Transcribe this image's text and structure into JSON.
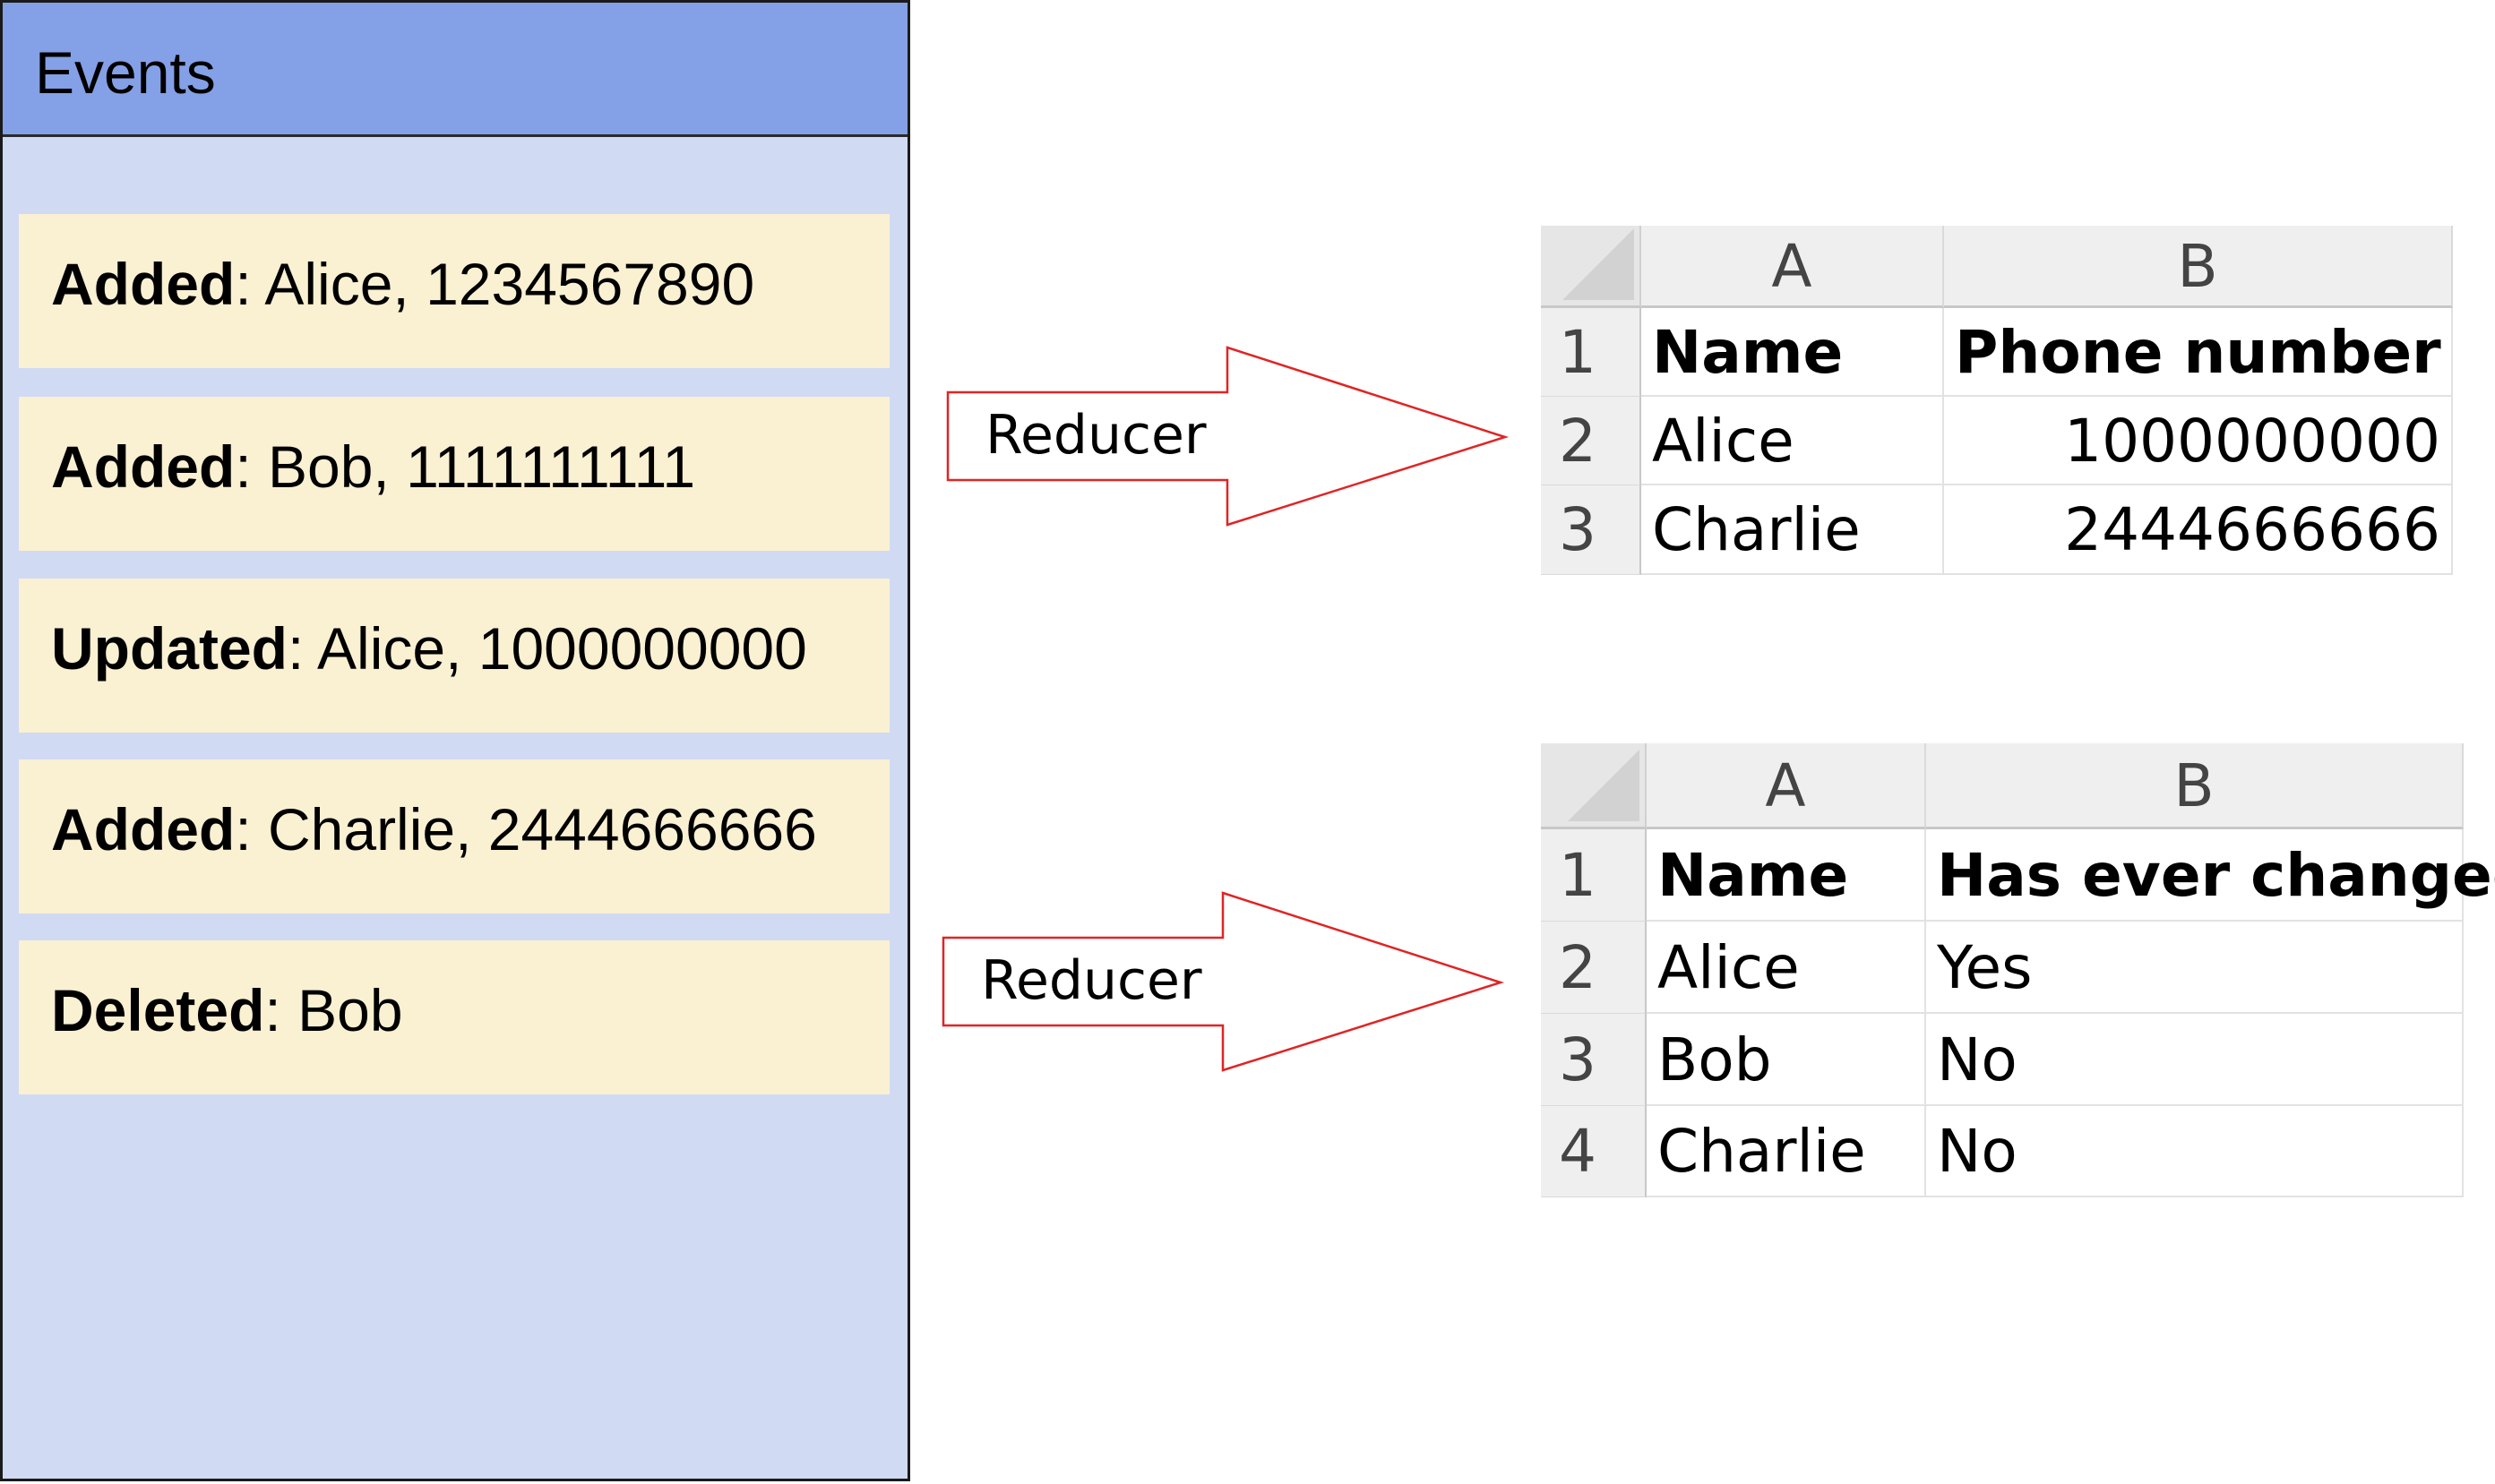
{
  "events_panel": {
    "title": "Events",
    "events": [
      {
        "action": "Added",
        "details": ": Alice, 1234567890"
      },
      {
        "action": "Added",
        "details": ": Bob, 1111111111"
      },
      {
        "action": "Updated",
        "details": ": Alice, 1000000000"
      },
      {
        "action": "Added",
        "details": ": Charlie, 2444666666"
      },
      {
        "action": "Deleted",
        "details": ": Bob"
      }
    ]
  },
  "arrows": [
    {
      "label": "Reducer",
      "color": "#e02424"
    },
    {
      "label": "Reducer",
      "color": "#e02424"
    }
  ],
  "sheets": [
    {
      "columns": [
        "A",
        "B"
      ],
      "rows": [
        {
          "num": "1",
          "cells": [
            "Name",
            "Phone number"
          ]
        },
        {
          "num": "2",
          "cells": [
            "Alice",
            "1000000000"
          ]
        },
        {
          "num": "3",
          "cells": [
            "Charlie",
            "2444666666"
          ]
        }
      ]
    },
    {
      "columns": [
        "A",
        "B"
      ],
      "rows": [
        {
          "num": "1",
          "cells": [
            "Name",
            "Has ever changed"
          ]
        },
        {
          "num": "2",
          "cells": [
            "Alice",
            "Yes"
          ]
        },
        {
          "num": "3",
          "cells": [
            "Bob",
            "No"
          ]
        },
        {
          "num": "4",
          "cells": [
            "Charlie",
            "No"
          ]
        }
      ]
    }
  ]
}
